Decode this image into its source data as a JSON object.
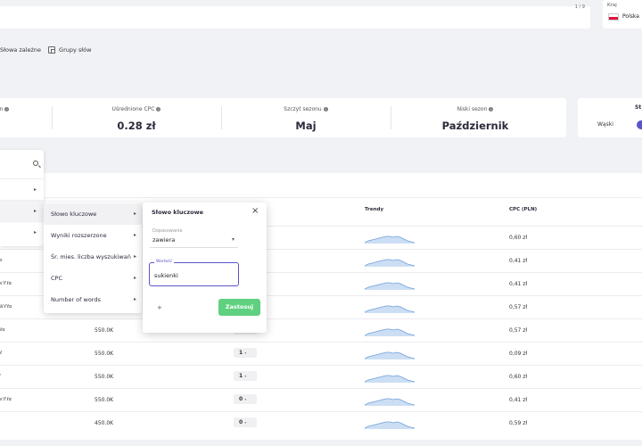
{
  "search": {
    "counter": "1 / 9"
  },
  "country": {
    "label": "Kraj",
    "value": "Polska"
  },
  "tabs": [
    {
      "label": "Słowa zależne"
    },
    {
      "label": "Grupy słów"
    }
  ],
  "stats": [
    {
      "label": "n",
      "value": ""
    },
    {
      "label": "Uśrednione CPC",
      "value": "0.28 zł"
    },
    {
      "label": "Szczyt sezonu",
      "value": "Maj"
    },
    {
      "label": "Niski sezon",
      "value": "Październik"
    }
  ],
  "wide_toggle": {
    "title": "St",
    "label": "Wąski"
  },
  "table": {
    "headers": {
      "trends": "Trendy",
      "cpc": "CPC (PLN)"
    },
    "rows": [
      {
        "kw": "",
        "vol": "",
        "kd": "",
        "cpc": "0,60 zł"
      },
      {
        "kw": "ε",
        "vol": "",
        "kd": "",
        "cpc": "0,41 zł"
      },
      {
        "kw": "ε'ℓ'ℓα",
        "vol": "",
        "kd": "",
        "cpc": "0,41 zł"
      },
      {
        "kw": "ä'ℓ'ℓα",
        "vol": "",
        "kd": "",
        "cpc": "0,57 zł"
      },
      {
        "kw": "ℓα",
        "vol": "550.0K",
        "kd": "0",
        "cpc": "0,57 zł"
      },
      {
        "kw": "ℓ",
        "vol": "550.0K",
        "kd": "1",
        "cpc": "0,09 zł"
      },
      {
        "kw": "'",
        "vol": "550.0K",
        "kd": "1",
        "cpc": "0,60 zł"
      },
      {
        "kw": "ε'ℓ'ℓα",
        "vol": "550.0K",
        "kd": "0",
        "cpc": "0,41 zł"
      },
      {
        "kw": "",
        "vol": "450.0K",
        "kd": "0",
        "cpc": "0,59 zł"
      }
    ]
  },
  "filter_menu": {
    "items": [
      {
        "label": "Słowo kluczowe"
      },
      {
        "label": "Wyniki rozszerzone"
      },
      {
        "label": "Śr. mies. liczba wyszukiwań"
      },
      {
        "label": "CPC"
      },
      {
        "label": "Number of words"
      }
    ]
  },
  "keyword_panel": {
    "title": "Słowo kluczowe",
    "select_label": "Dopasowanie",
    "select_value": "zawiera",
    "input_label": "Wartość",
    "input_value": "sukienki",
    "add_label": "+",
    "apply_label": "Zastosuj"
  },
  "colors": {
    "accent": "#5a54c9",
    "apply": "#5fd07f",
    "trend": "#a9c8ec"
  }
}
